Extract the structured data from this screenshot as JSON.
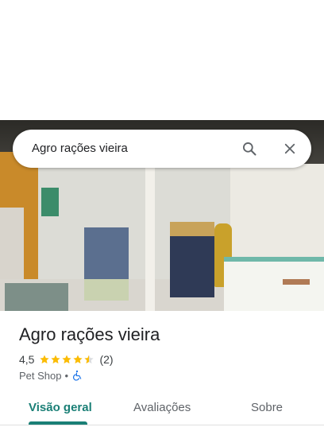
{
  "search": {
    "query": "Agro rações vieira",
    "search_icon": "search-icon",
    "close_icon": "close-icon"
  },
  "place": {
    "name": "Agro rações vieira",
    "rating": "4,5",
    "rating_value": 4.5,
    "rating_max": 5,
    "review_count": "(2)",
    "category": "Pet Shop",
    "separator": "•",
    "accessibility_icon": "wheelchair-icon"
  },
  "tabs": [
    {
      "label": "Visão geral",
      "active": true
    },
    {
      "label": "Avaliações",
      "active": false
    },
    {
      "label": "Sobre",
      "active": false
    }
  ],
  "colors": {
    "accent": "#1a7f76",
    "star": "#fbbc04",
    "star_empty": "#dadce0",
    "accessibility": "#1a73e8"
  }
}
